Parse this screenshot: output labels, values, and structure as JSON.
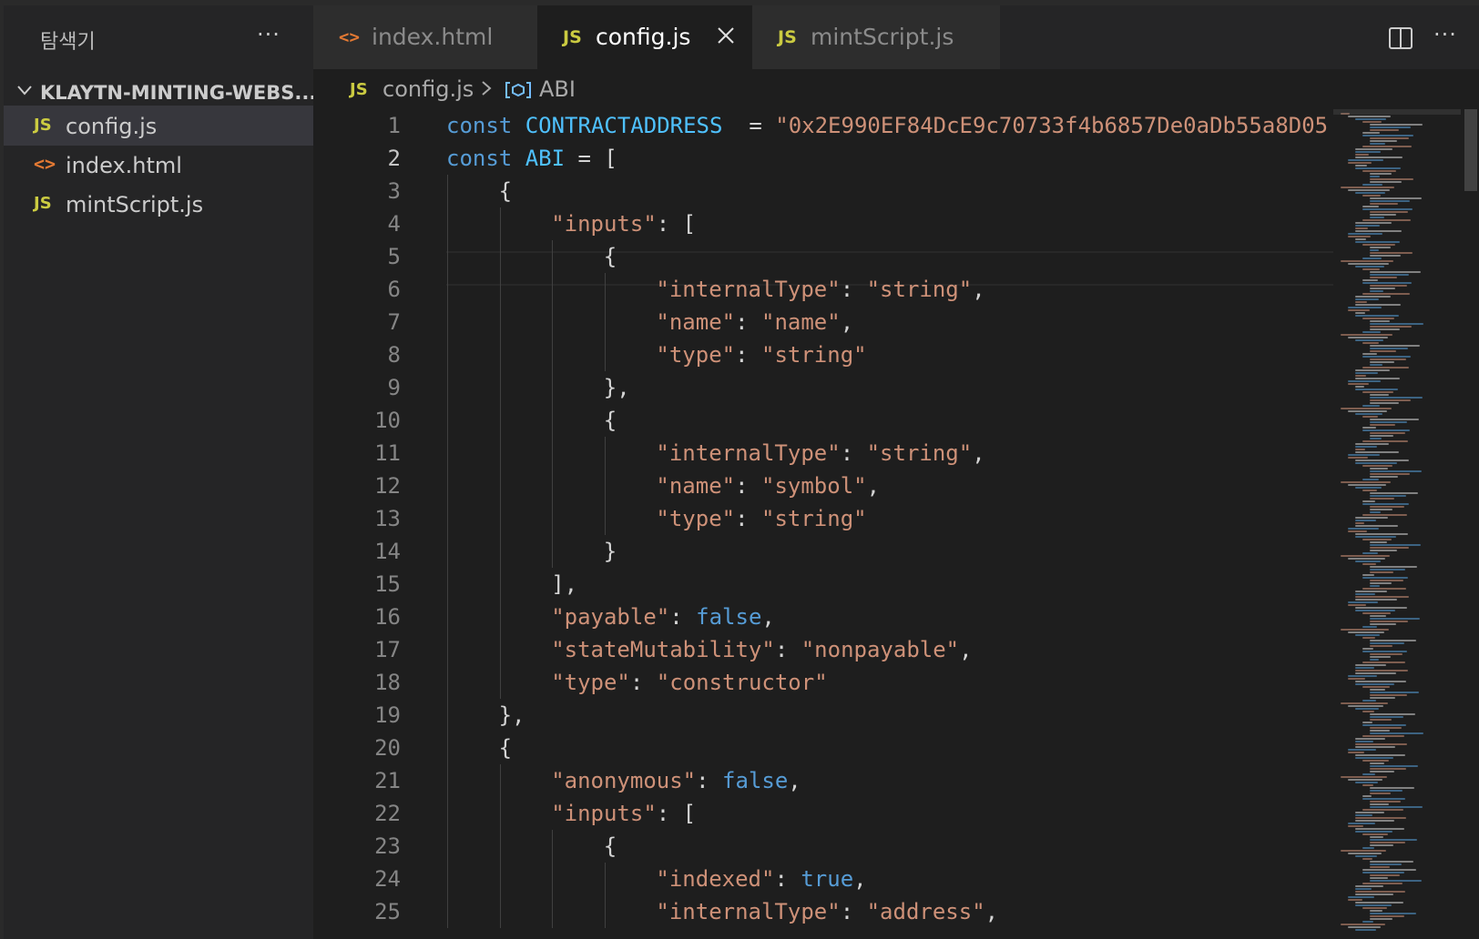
{
  "sidebar": {
    "title": "탐색기",
    "more_label": "···",
    "folder": "KLAYTN-MINTING-WEBS...",
    "files": [
      {
        "name": "config.js",
        "kind": "js",
        "icon_text": "JS",
        "active": true
      },
      {
        "name": "index.html",
        "kind": "html",
        "icon_text": "<>",
        "active": false
      },
      {
        "name": "mintScript.js",
        "kind": "js",
        "icon_text": "JS",
        "active": false
      }
    ]
  },
  "tabs": [
    {
      "label": "index.html",
      "icon_text": "<>",
      "kind": "html",
      "active": false
    },
    {
      "label": "config.js",
      "icon_text": "JS",
      "kind": "js",
      "active": true
    },
    {
      "label": "mintScript.js",
      "icon_text": "JS",
      "kind": "js",
      "active": false
    }
  ],
  "toolbar": {
    "more_label": "···"
  },
  "breadcrumb": {
    "icon_text": "JS",
    "file": "config.js",
    "symbol": "ABI"
  },
  "editor": {
    "current_line": 2,
    "lines": [
      {
        "n": "1",
        "indent": 0,
        "tokens": [
          {
            "t": "kw",
            "v": "const "
          },
          {
            "t": "cn",
            "v": "CONTRACTADDRESS"
          },
          {
            "t": "pn",
            "v": "  = "
          },
          {
            "t": "str",
            "v": "\"0x2E990EF84DcE9c70733f4b6857De0aDb55a8D05"
          }
        ]
      },
      {
        "n": "2",
        "indent": 0,
        "tokens": [
          {
            "t": "kw",
            "v": "const "
          },
          {
            "t": "cn",
            "v": "ABI"
          },
          {
            "t": "pn",
            "v": " = ["
          }
        ]
      },
      {
        "n": "3",
        "indent": 1,
        "tokens": [
          {
            "t": "pn",
            "v": "{"
          }
        ]
      },
      {
        "n": "4",
        "indent": 2,
        "tokens": [
          {
            "t": "str",
            "v": "\"inputs\""
          },
          {
            "t": "pn",
            "v": ": ["
          }
        ]
      },
      {
        "n": "5",
        "indent": 3,
        "tokens": [
          {
            "t": "pn",
            "v": "{"
          }
        ]
      },
      {
        "n": "6",
        "indent": 4,
        "tokens": [
          {
            "t": "str",
            "v": "\"internalType\""
          },
          {
            "t": "pn",
            "v": ": "
          },
          {
            "t": "str",
            "v": "\"string\""
          },
          {
            "t": "pn",
            "v": ","
          }
        ]
      },
      {
        "n": "7",
        "indent": 4,
        "tokens": [
          {
            "t": "str",
            "v": "\"name\""
          },
          {
            "t": "pn",
            "v": ": "
          },
          {
            "t": "str",
            "v": "\"name\""
          },
          {
            "t": "pn",
            "v": ","
          }
        ]
      },
      {
        "n": "8",
        "indent": 4,
        "tokens": [
          {
            "t": "str",
            "v": "\"type\""
          },
          {
            "t": "pn",
            "v": ": "
          },
          {
            "t": "str",
            "v": "\"string\""
          }
        ]
      },
      {
        "n": "9",
        "indent": 3,
        "tokens": [
          {
            "t": "pn",
            "v": "},"
          }
        ]
      },
      {
        "n": "10",
        "indent": 3,
        "tokens": [
          {
            "t": "pn",
            "v": "{"
          }
        ]
      },
      {
        "n": "11",
        "indent": 4,
        "tokens": [
          {
            "t": "str",
            "v": "\"internalType\""
          },
          {
            "t": "pn",
            "v": ": "
          },
          {
            "t": "str",
            "v": "\"string\""
          },
          {
            "t": "pn",
            "v": ","
          }
        ]
      },
      {
        "n": "12",
        "indent": 4,
        "tokens": [
          {
            "t": "str",
            "v": "\"name\""
          },
          {
            "t": "pn",
            "v": ": "
          },
          {
            "t": "str",
            "v": "\"symbol\""
          },
          {
            "t": "pn",
            "v": ","
          }
        ]
      },
      {
        "n": "13",
        "indent": 4,
        "tokens": [
          {
            "t": "str",
            "v": "\"type\""
          },
          {
            "t": "pn",
            "v": ": "
          },
          {
            "t": "str",
            "v": "\"string\""
          }
        ]
      },
      {
        "n": "14",
        "indent": 3,
        "tokens": [
          {
            "t": "pn",
            "v": "}"
          }
        ]
      },
      {
        "n": "15",
        "indent": 2,
        "tokens": [
          {
            "t": "pn",
            "v": "],"
          }
        ]
      },
      {
        "n": "16",
        "indent": 2,
        "tokens": [
          {
            "t": "str",
            "v": "\"payable\""
          },
          {
            "t": "pn",
            "v": ": "
          },
          {
            "t": "bool",
            "v": "false"
          },
          {
            "t": "pn",
            "v": ","
          }
        ]
      },
      {
        "n": "17",
        "indent": 2,
        "tokens": [
          {
            "t": "str",
            "v": "\"stateMutability\""
          },
          {
            "t": "pn",
            "v": ": "
          },
          {
            "t": "str",
            "v": "\"nonpayable\""
          },
          {
            "t": "pn",
            "v": ","
          }
        ]
      },
      {
        "n": "18",
        "indent": 2,
        "tokens": [
          {
            "t": "str",
            "v": "\"type\""
          },
          {
            "t": "pn",
            "v": ": "
          },
          {
            "t": "str",
            "v": "\"constructor\""
          }
        ]
      },
      {
        "n": "19",
        "indent": 1,
        "tokens": [
          {
            "t": "pn",
            "v": "},"
          }
        ]
      },
      {
        "n": "20",
        "indent": 1,
        "tokens": [
          {
            "t": "pn",
            "v": "{"
          }
        ]
      },
      {
        "n": "21",
        "indent": 2,
        "tokens": [
          {
            "t": "str",
            "v": "\"anonymous\""
          },
          {
            "t": "pn",
            "v": ": "
          },
          {
            "t": "bool",
            "v": "false"
          },
          {
            "t": "pn",
            "v": ","
          }
        ]
      },
      {
        "n": "22",
        "indent": 2,
        "tokens": [
          {
            "t": "str",
            "v": "\"inputs\""
          },
          {
            "t": "pn",
            "v": ": ["
          }
        ]
      },
      {
        "n": "23",
        "indent": 3,
        "tokens": [
          {
            "t": "pn",
            "v": "{"
          }
        ]
      },
      {
        "n": "24",
        "indent": 4,
        "tokens": [
          {
            "t": "str",
            "v": "\"indexed\""
          },
          {
            "t": "pn",
            "v": ": "
          },
          {
            "t": "bool",
            "v": "true"
          },
          {
            "t": "pn",
            "v": ","
          }
        ]
      },
      {
        "n": "25",
        "indent": 4,
        "tokens": [
          {
            "t": "str",
            "v": "\"internalType\""
          },
          {
            "t": "pn",
            "v": ": "
          },
          {
            "t": "str",
            "v": "\"address\""
          },
          {
            "t": "pn",
            "v": ","
          }
        ]
      }
    ]
  },
  "colors": {
    "keyword": "#569cd6",
    "constant": "#4fc1ff",
    "string": "#ce9178",
    "punctuation": "#d4d4d4",
    "js_icon": "#cbcb41",
    "html_icon": "#e37933"
  }
}
